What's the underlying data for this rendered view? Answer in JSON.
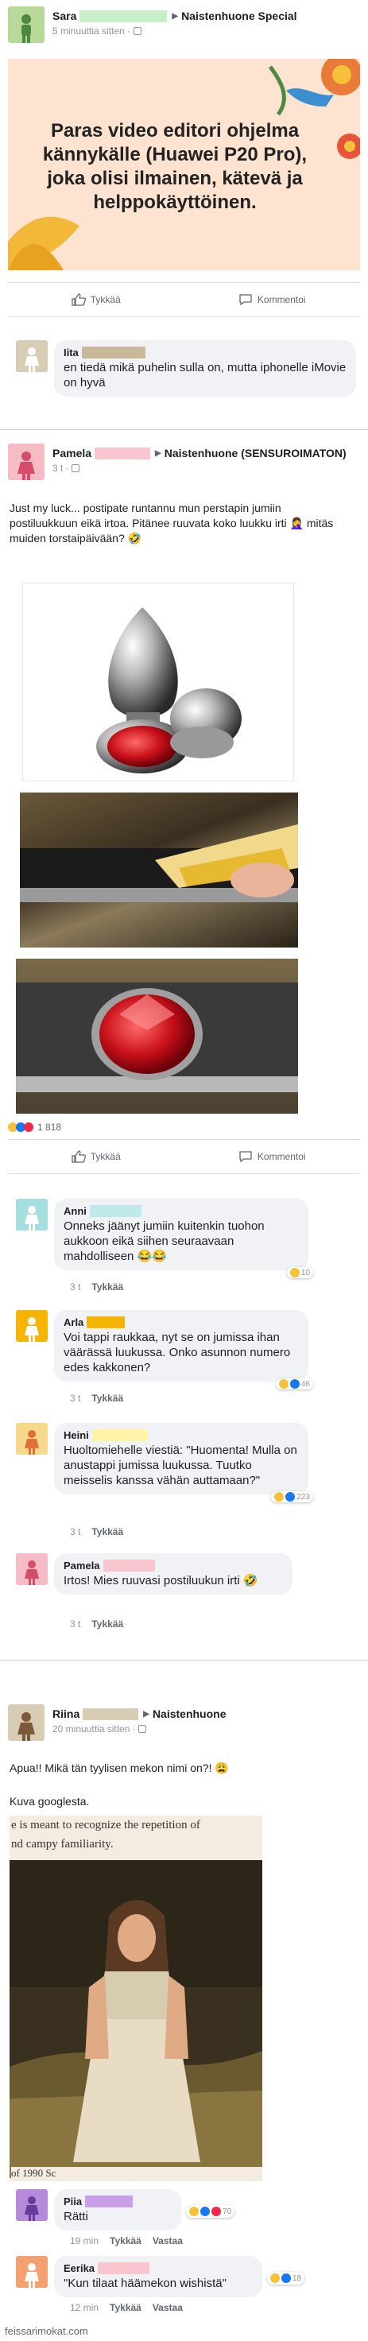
{
  "post1": {
    "author": "Sara",
    "group": "Naistenhuone Special",
    "time": "5 minuuttia sitten",
    "banner_text": "Paras video editori ohjelma kännykälle (Huawei P20 Pro), joka olisi ilmainen, kätevä ja helppokäyttöinen.",
    "like_label": "Tykkää",
    "comment_label": "Kommentoi",
    "comment": {
      "author": "Iita",
      "text": "en tiedä mikä puhelin sulla on, mutta iphonelle iMovie on hyvä"
    }
  },
  "post2": {
    "author": "Pamela",
    "group": "Naistenhuone (SENSUROIMATON)",
    "time": "3 t",
    "text": "Just my luck... postipate runtannu mun perstapin jumiin postiluukkuun eikä irtoa. Pitänee ruuvata koko luukku irti 🤦‍♀️ mitäs muiden torstaipäivään? 🤣",
    "reaction_count": "1 818",
    "like_label": "Tykkää",
    "comment_label": "Kommentoi",
    "comments": [
      {
        "author": "Anni",
        "text": "Onneks jäänyt jumiin kuitenkin tuohon aukkoon eikä siihen seuraavaan mahdolliseen 😂😂",
        "time": "3 t",
        "like": "Tykkää",
        "reactions": "10"
      },
      {
        "author": "Arla",
        "text": "Voi tappi raukkaa, nyt se on jumissa ihan väärässä luukussa. Onko asunnon numero edes kakkonen?",
        "time": "3 t",
        "like": "Tykkää",
        "reactions": "46"
      },
      {
        "author": "Heini",
        "text": "Huoltomiehelle viestiä: \"Huomenta! Mulla on anustappi jumissa luukussa. Tuutko meisselis kanssa vähän auttamaan?\"",
        "time": "3 t",
        "like": "Tykkää",
        "reactions": "223"
      },
      {
        "author": "Pamela",
        "text": "Irtos! Mies ruuvasi postiluukun  irti 🤣",
        "time": "3 t",
        "like": "Tykkää",
        "reactions": ""
      }
    ]
  },
  "post3": {
    "author": "Riina",
    "group": "Naistenhuone",
    "time": "20 minuuttia sitten",
    "text1": "Apua!! Mikä tän tyylisen mekon nimi on?! 😩",
    "text2": "Kuva googlesta.",
    "photo_caption_top": "e is meant to recognize the repetition of",
    "photo_caption_top2": "nd campy familiarity.",
    "photo_caption_bottom": "of 1990 Sc",
    "comments": [
      {
        "author": "Piia",
        "text": "Rätti",
        "time": "19 min",
        "like": "Tykkää",
        "reply": "Vastaa",
        "reactions": "70"
      },
      {
        "author": "Eerika",
        "text": "\"Kun tilaat häämekon wishistä\"",
        "time": "12 min",
        "like": "Tykkää",
        "reply": "Vastaa",
        "reactions": "18"
      }
    ]
  },
  "watermark": "feissarimokat.com"
}
